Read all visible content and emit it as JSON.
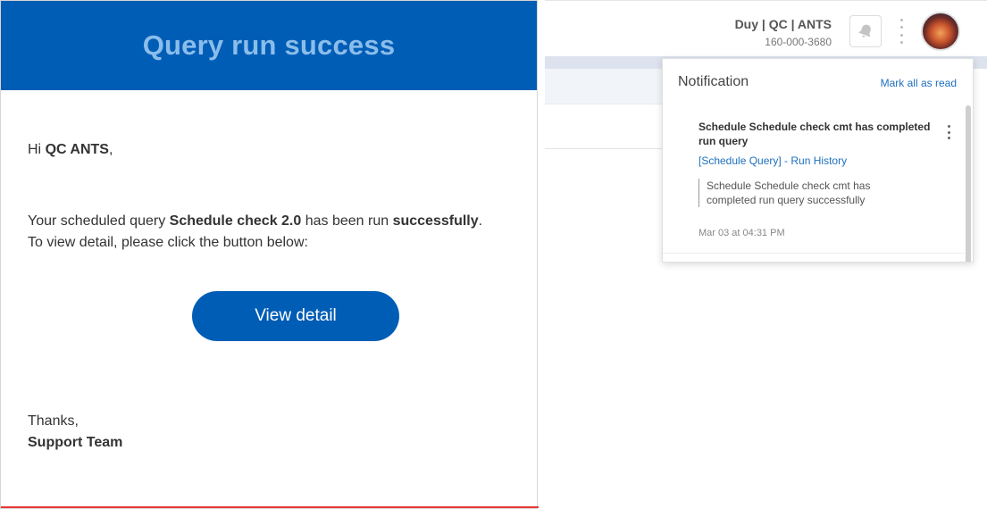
{
  "email": {
    "title": "Query run success",
    "greeting_prefix": "Hi ",
    "greeting_name": "QC ANTS",
    "greeting_suffix": ",",
    "message_prefix": "Your scheduled query ",
    "query_name": "Schedule check 2.0",
    "message_mid": " has been run ",
    "message_status": "successfully",
    "message_end": ".",
    "instruction": "To view detail, please click the button below:",
    "button_label": "View detail",
    "thanks": "Thanks,",
    "signature": "Support Team"
  },
  "header": {
    "user_name": "Duy | QC | ANTS",
    "user_phone": "160-000-3680",
    "bell_icon": "bell-icon",
    "more_icon": "more-vertical-icon"
  },
  "notification": {
    "title": "Notification",
    "mark_all_label": "Mark all as read",
    "items": [
      {
        "title": "Schedule Schedule check cmt has completed run query",
        "link": "[Schedule Query] - Run History",
        "message": "Schedule Schedule check cmt has completed run query successfully",
        "time": "Mar 03 at 04:31 PM"
      }
    ]
  },
  "colors": {
    "brand_blue": "#005db5",
    "title_blue": "#8bbdeb",
    "link_blue": "#1f6fbf",
    "bottom_red": "#e53935"
  }
}
